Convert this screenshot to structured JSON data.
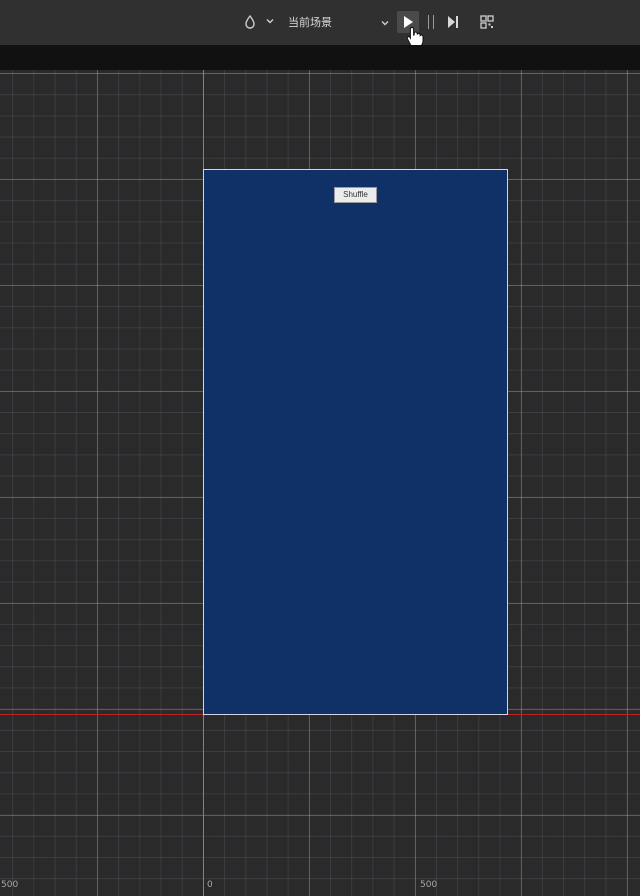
{
  "toolbar": {
    "platform_icon": "drop-icon",
    "platform_chevron": "chevron-down-icon",
    "scene_label": "当前场景",
    "scene_chevron": "chevron-down-icon",
    "play_icon": "play-icon",
    "pause_icon": "pause-icon",
    "step_icon": "step-forward-icon",
    "qr_icon": "qr-code-icon"
  },
  "scene": {
    "shuffle_label": "Shuffle"
  },
  "ruler": {
    "label_left": "500",
    "label_zero": "0",
    "label_right": "500"
  },
  "colors": {
    "canvas_bg": "#0f3168",
    "axis_x": "#c02020",
    "axis_y": "#22c322",
    "toolbar_bg": "#303030",
    "viewport_bg": "#2a2a2a"
  }
}
